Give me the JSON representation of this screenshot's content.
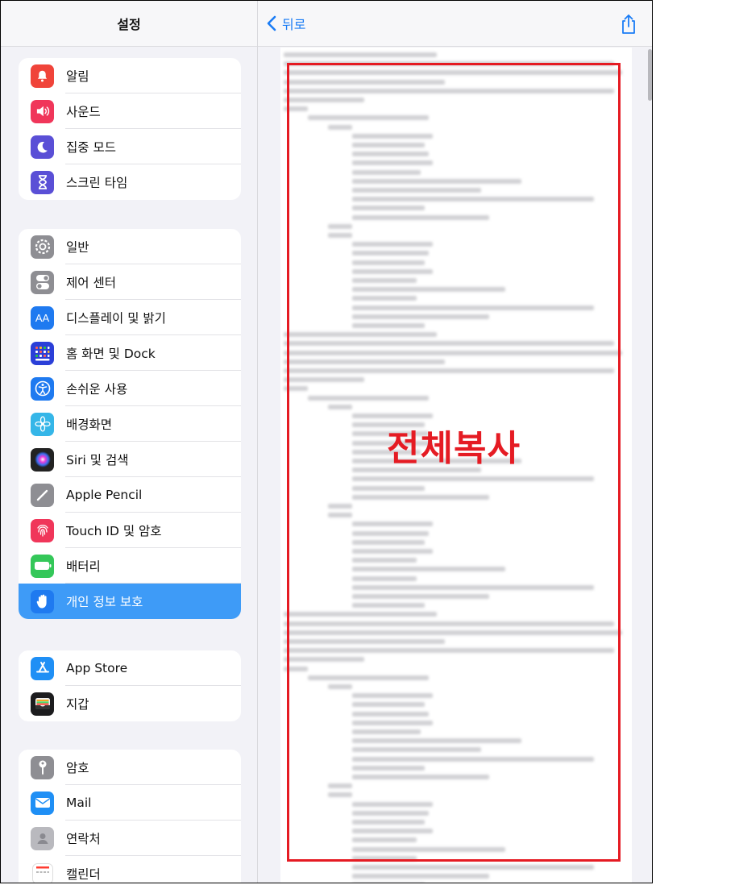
{
  "sidebar": {
    "title": "설정",
    "groups": [
      [
        {
          "label": "알림",
          "icon": "bell-icon",
          "color": "#f0443a"
        },
        {
          "label": "사운드",
          "icon": "speaker-icon",
          "color": "#f0365a"
        },
        {
          "label": "집중 모드",
          "icon": "moon-icon",
          "color": "#5a4fd6"
        },
        {
          "label": "스크린 타임",
          "icon": "hourglass-icon",
          "color": "#5a4fd6"
        }
      ],
      [
        {
          "label": "일반",
          "icon": "gear-icon",
          "color": "#8e8e93"
        },
        {
          "label": "제어 센터",
          "icon": "toggles-icon",
          "color": "#8e8e93"
        },
        {
          "label": "디스플레이 및 밝기",
          "icon": "text-size-icon",
          "color": "#1f7af0"
        },
        {
          "label": "홈 화면 및 Dock",
          "icon": "app-grid-icon",
          "color": "#2b3fd8"
        },
        {
          "label": "손쉬운 사용",
          "icon": "accessibility-icon",
          "color": "#1f7af0"
        },
        {
          "label": "배경화면",
          "icon": "flower-icon",
          "color": "#35b6e8"
        },
        {
          "label": "Siri 및 검색",
          "icon": "siri-icon",
          "color": "#222222"
        },
        {
          "label": "Apple Pencil",
          "icon": "pencil-icon",
          "color": "#8e8e93"
        },
        {
          "label": "Touch ID 및 암호",
          "icon": "fingerprint-icon",
          "color": "#f0365a"
        },
        {
          "label": "배터리",
          "icon": "battery-icon",
          "color": "#34c759"
        },
        {
          "label": "개인 정보 보호",
          "icon": "hand-icon",
          "color": "#1f7af0",
          "active": true
        }
      ],
      [
        {
          "label": "App Store",
          "icon": "app-store-icon",
          "color": "#1f8ff5"
        },
        {
          "label": "지갑",
          "icon": "wallet-icon",
          "color": "#1c1c1e"
        }
      ],
      [
        {
          "label": "암호",
          "icon": "key-icon",
          "color": "#8e8e93"
        },
        {
          "label": "Mail",
          "icon": "mail-icon",
          "color": "#1f8ff5"
        },
        {
          "label": "연락처",
          "icon": "contacts-icon",
          "color": "#b9b9be"
        },
        {
          "label": "캘린더",
          "icon": "calendar-icon",
          "color": "#ffffff"
        }
      ]
    ]
  },
  "detail": {
    "back_label": "뒤로",
    "share_icon": "share-icon"
  },
  "annotation": {
    "label": "전체복사",
    "color": "#e51b23"
  }
}
